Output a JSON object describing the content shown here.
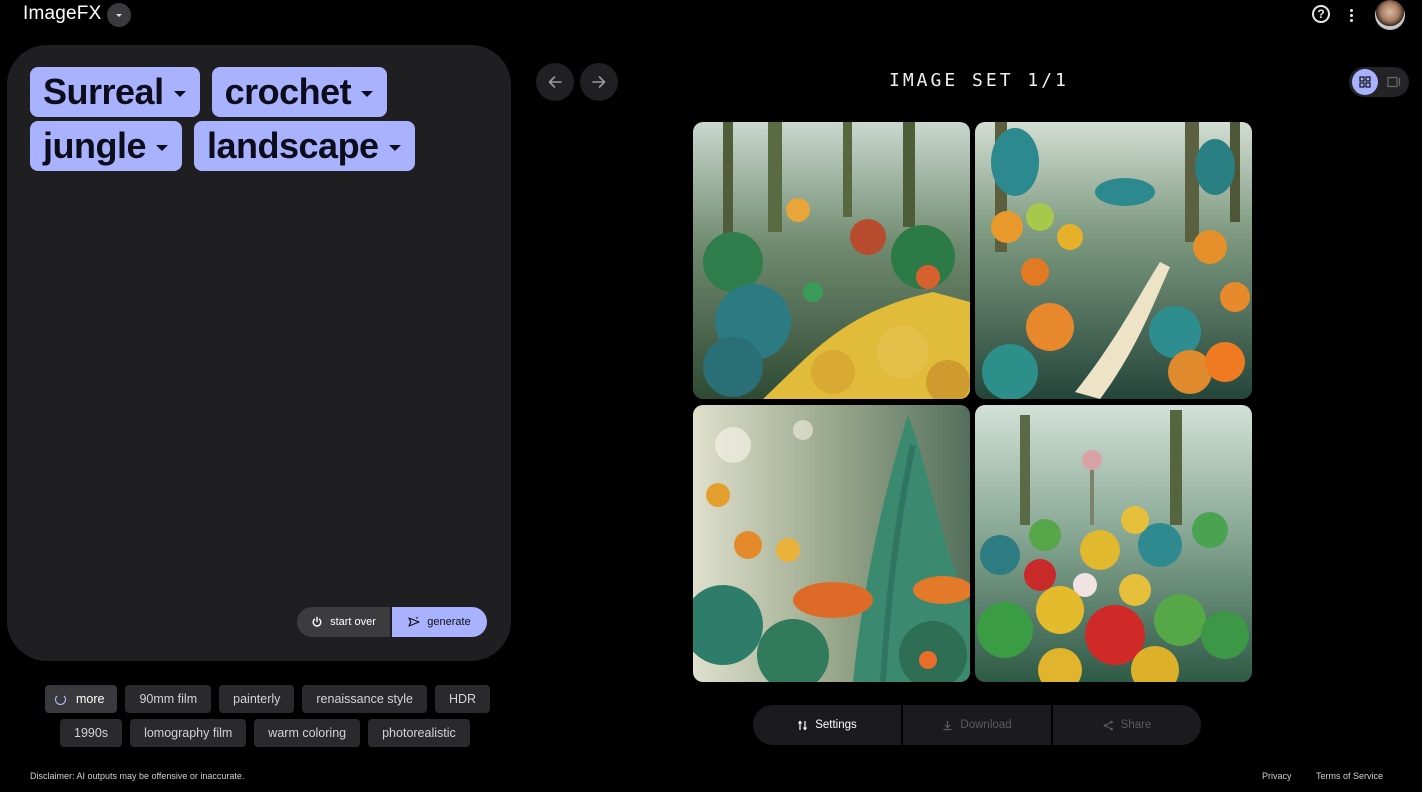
{
  "app": {
    "title": "ImageFX"
  },
  "prompt": {
    "words": [
      "Surreal",
      "crochet",
      "jungle",
      "landscape"
    ],
    "start_over_label": "start over",
    "generate_label": "generate"
  },
  "suggestions": {
    "more_label": "more",
    "chips": [
      "90mm film",
      "painterly",
      "renaissance style",
      "HDR",
      "1990s",
      "lomography film",
      "warm coloring",
      "photorealistic"
    ]
  },
  "results": {
    "title": "IMAGE SET 1/1",
    "images": [
      "generated-image-1",
      "generated-image-2",
      "generated-image-3",
      "generated-image-4"
    ],
    "actions": {
      "settings": "Settings",
      "download": "Download",
      "share": "Share"
    }
  },
  "footer": {
    "disclaimer": "Disclaimer: AI outputs may be offensive or inaccurate.",
    "privacy": "Privacy",
    "terms": "Terms of Service"
  },
  "colors": {
    "accent": "#a8b2ff",
    "panel": "#1f1f21",
    "background": "#000000"
  },
  "icons": [
    "help-icon",
    "more-vert-icon",
    "arrow-back-icon",
    "arrow-forward-icon",
    "grid-view-icon",
    "single-view-icon",
    "refresh-icon",
    "power-icon",
    "send-sparkle-icon",
    "tune-icon",
    "download-icon",
    "share-icon"
  ]
}
